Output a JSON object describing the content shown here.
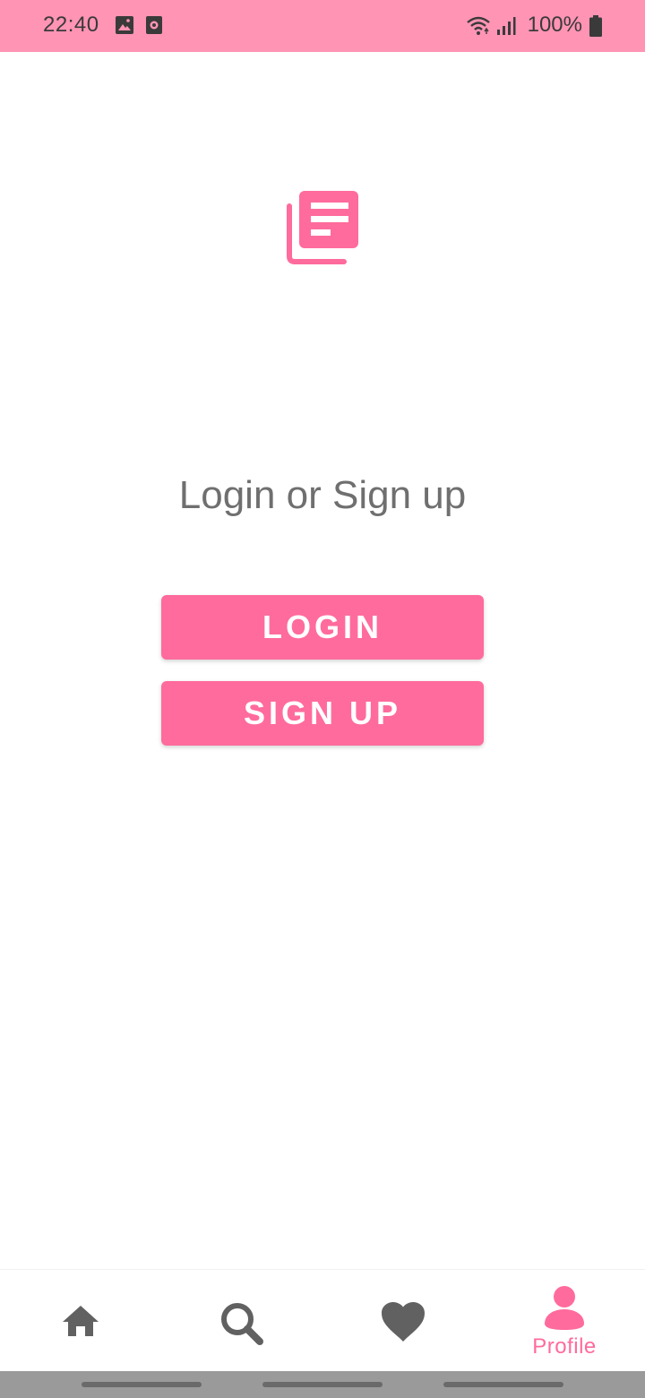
{
  "status_bar": {
    "time": "22:40",
    "icons": [
      "image-icon",
      "media-icon",
      "wifi-icon",
      "signal-icon",
      "battery-icon"
    ],
    "battery_text": "100%"
  },
  "logo": {
    "icon": "article-stack-icon",
    "color": "#ff6b9c"
  },
  "auth": {
    "title": "Login or Sign up",
    "login_label": "LOGIN",
    "signup_label": "SIGN UP"
  },
  "bottom_nav": {
    "items": [
      {
        "icon": "home-icon",
        "label": ""
      },
      {
        "icon": "search-icon",
        "label": ""
      },
      {
        "icon": "heart-icon",
        "label": ""
      },
      {
        "icon": "profile-icon",
        "label": "Profile"
      }
    ],
    "active_index": 3
  },
  "colors": {
    "status_bar": "#ff94b5",
    "accent": "#ff6b9c",
    "nav_inactive": "#616161",
    "title_text": "#6f6f6f"
  }
}
